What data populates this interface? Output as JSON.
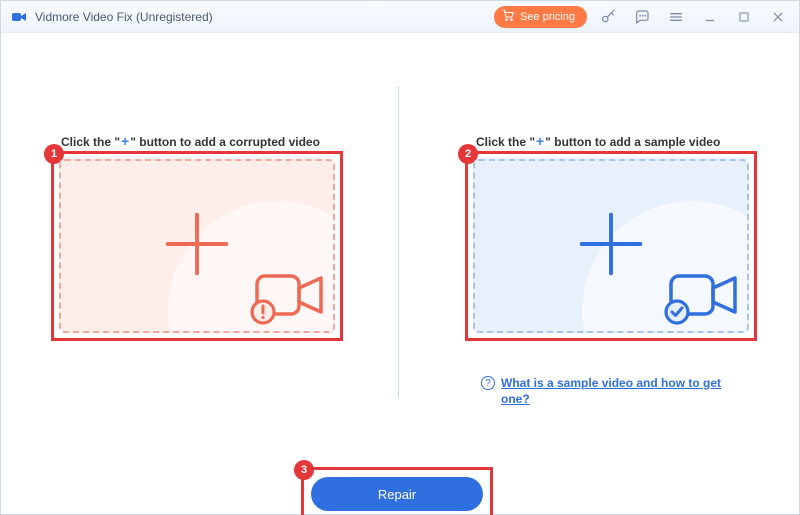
{
  "titlebar": {
    "app_name": "Vidmore Video Fix (Unregistered)",
    "see_pricing_label": "See pricing"
  },
  "panels": {
    "left": {
      "title_prefix": "Click the \"",
      "title_suffix": "\" button to add a corrupted video",
      "plus_glyph": "+"
    },
    "right": {
      "title_prefix": "Click the \"",
      "title_suffix": "\" button to add a sample video",
      "plus_glyph": "+"
    }
  },
  "help": {
    "link_text": "What is a sample video and how to get one?"
  },
  "actions": {
    "repair_label": "Repair"
  },
  "annotations": {
    "badge1": "1",
    "badge2": "2",
    "badge3": "3"
  },
  "colors": {
    "accent_blue": "#2f6fe0",
    "accent_orange": "#ff7a45",
    "highlight_red": "#e4373a",
    "dropzone_red": "#f3a6a0",
    "dropzone_blue": "#a5c3ed"
  }
}
